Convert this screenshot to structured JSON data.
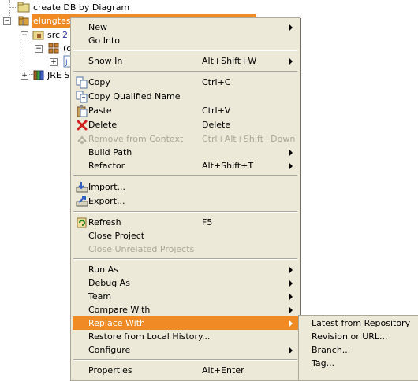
{
  "tree": {
    "items": [
      {
        "label": "create DB by Diagram",
        "icon": "folder-icon"
      },
      {
        "label": "elungtest",
        "icon": "project-icon",
        "selected": true
      },
      {
        "label": "src",
        "suffix": "2",
        "icon": "source-folder-icon"
      },
      {
        "label": "(c",
        "icon": "package-icon"
      },
      {
        "label": "",
        "icon": "java-file-icon"
      },
      {
        "label": "JRE S",
        "icon": "library-icon"
      }
    ]
  },
  "menu": {
    "items": [
      {
        "label": "New",
        "shortcut": "",
        "submenu": true,
        "icon": "",
        "enabled": true
      },
      {
        "label": "Go Into",
        "shortcut": "",
        "submenu": false,
        "icon": "",
        "enabled": true
      },
      {
        "label": "Show In",
        "shortcut": "Alt+Shift+W",
        "submenu": true,
        "icon": "",
        "enabled": true
      },
      {
        "label": "Copy",
        "shortcut": "Ctrl+C",
        "submenu": false,
        "icon": "copy-icon",
        "enabled": true
      },
      {
        "label": "Copy Qualified Name",
        "shortcut": "",
        "submenu": false,
        "icon": "copy-qualified-name-icon",
        "enabled": true
      },
      {
        "label": "Paste",
        "shortcut": "Ctrl+V",
        "submenu": false,
        "icon": "paste-icon",
        "enabled": true
      },
      {
        "label": "Delete",
        "shortcut": "Delete",
        "submenu": false,
        "icon": "delete-icon",
        "enabled": true
      },
      {
        "label": "Remove from Context",
        "shortcut": "Ctrl+Alt+Shift+Down",
        "submenu": false,
        "icon": "remove-from-context-icon",
        "enabled": false
      },
      {
        "label": "Build Path",
        "shortcut": "",
        "submenu": true,
        "icon": "",
        "enabled": true
      },
      {
        "label": "Refactor",
        "shortcut": "Alt+Shift+T",
        "submenu": true,
        "icon": "",
        "enabled": true
      },
      {
        "label": "Import...",
        "shortcut": "",
        "submenu": false,
        "icon": "import-icon",
        "enabled": true
      },
      {
        "label": "Export...",
        "shortcut": "",
        "submenu": false,
        "icon": "export-icon",
        "enabled": true
      },
      {
        "label": "Refresh",
        "shortcut": "F5",
        "submenu": false,
        "icon": "refresh-icon",
        "enabled": true
      },
      {
        "label": "Close Project",
        "shortcut": "",
        "submenu": false,
        "icon": "",
        "enabled": true
      },
      {
        "label": "Close Unrelated Projects",
        "shortcut": "",
        "submenu": false,
        "icon": "",
        "enabled": false
      },
      {
        "label": "Run As",
        "shortcut": "",
        "submenu": true,
        "icon": "",
        "enabled": true
      },
      {
        "label": "Debug As",
        "shortcut": "",
        "submenu": true,
        "icon": "",
        "enabled": true
      },
      {
        "label": "Team",
        "shortcut": "",
        "submenu": true,
        "icon": "",
        "enabled": true
      },
      {
        "label": "Compare With",
        "shortcut": "",
        "submenu": true,
        "icon": "",
        "enabled": true
      },
      {
        "label": "Replace With",
        "shortcut": "",
        "submenu": true,
        "icon": "",
        "enabled": true,
        "highlighted": true
      },
      {
        "label": "Restore from Local History...",
        "shortcut": "",
        "submenu": false,
        "icon": "",
        "enabled": true
      },
      {
        "label": "Configure",
        "shortcut": "",
        "submenu": true,
        "icon": "",
        "enabled": true
      },
      {
        "label": "Properties",
        "shortcut": "Alt+Enter",
        "submenu": false,
        "icon": "",
        "enabled": true
      }
    ]
  },
  "submenu": {
    "items": [
      {
        "label": "Latest from Repository"
      },
      {
        "label": "Revision or URL..."
      },
      {
        "label": "Branch..."
      },
      {
        "label": "Tag..."
      }
    ]
  },
  "colors": {
    "menu_bg": "#ece9d8",
    "highlight": "#f08a24",
    "disabled_text": "#aca899"
  }
}
